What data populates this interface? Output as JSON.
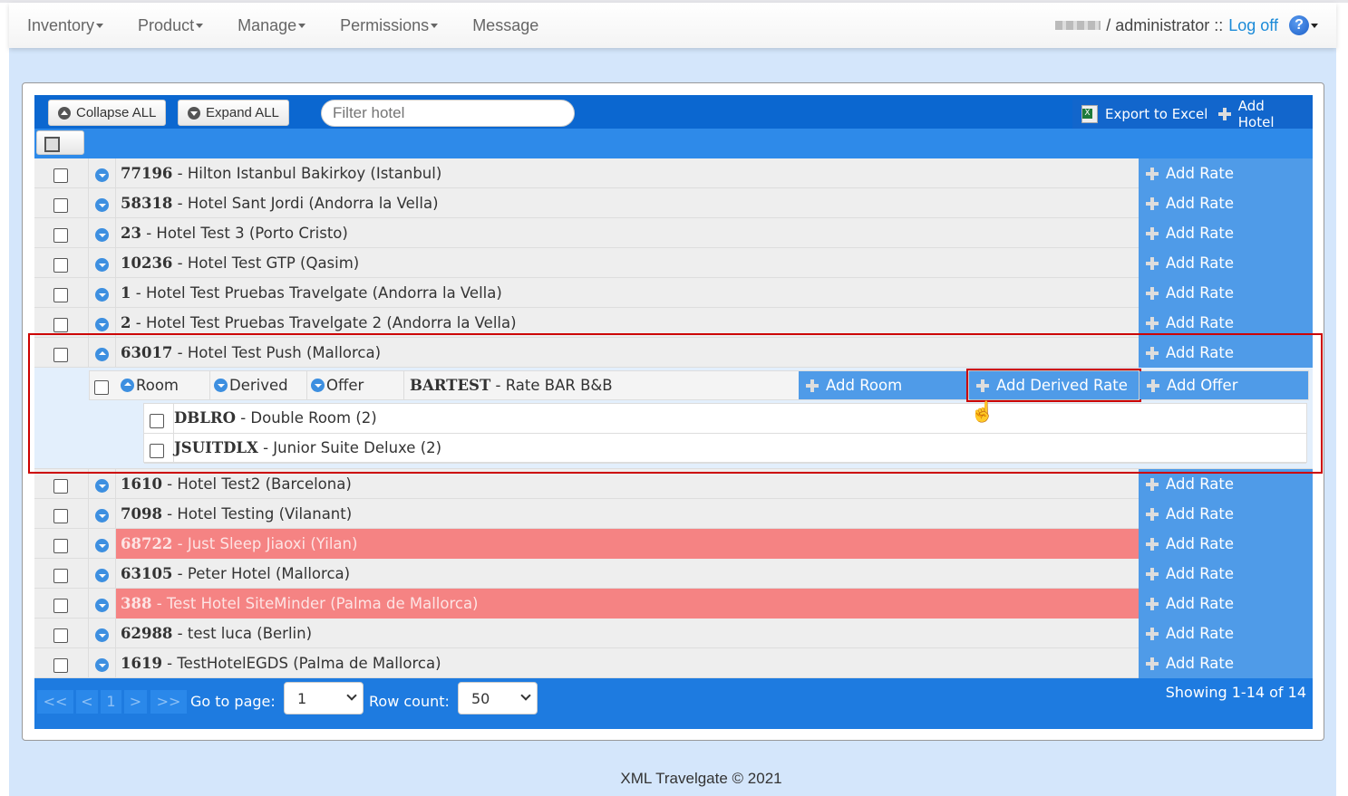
{
  "nav": {
    "items": [
      {
        "label": "Inventory",
        "caret": true
      },
      {
        "label": "Product",
        "caret": true
      },
      {
        "label": "Manage",
        "caret": true
      },
      {
        "label": "Permissions",
        "caret": true
      },
      {
        "label": "Message",
        "caret": false
      }
    ],
    "user_role": "/ administrator ::",
    "logoff": "Log off",
    "help_icon": "question-circle-icon"
  },
  "toolbar": {
    "collapse_all": "Collapse ALL",
    "expand_all": "Expand ALL",
    "filter_placeholder": "Filter hotel",
    "export": "Export to Excel",
    "add_hotel": "Add Hotel"
  },
  "add_rate_label": "Add Rate",
  "hotels_before": [
    {
      "code": "77196",
      "name": "Hilton Istanbul Bakirkoy (Istanbul)",
      "highlight": false
    },
    {
      "code": "58318",
      "name": "Hotel Sant Jordi (Andorra la Vella)",
      "highlight": false
    },
    {
      "code": "23",
      "name": "Hotel Test 3 (Porto Cristo)",
      "highlight": false
    },
    {
      "code": "10236",
      "name": "Hotel Test GTP (Qasim)",
      "highlight": false
    },
    {
      "code": "1",
      "name": "Hotel Test Pruebas Travelgate (Andorra la Vella)",
      "highlight": false
    },
    {
      "code": "2",
      "name": "Hotel Test Pruebas Travelgate 2 (Andorra la Vella)",
      "highlight": false
    },
    {
      "code": "63017",
      "name": "Hotel Test Push (Mallorca)",
      "highlight": false,
      "expanded": true
    }
  ],
  "expanded": {
    "tabs": [
      "Room",
      "Derived",
      "Offer"
    ],
    "rate_code": "BARTEST",
    "rate_name": "Rate BAR B&B",
    "add_room": "Add Room",
    "add_derived": "Add Derived Rate",
    "add_offer": "Add Offer",
    "rooms": [
      {
        "code": "DBLRO",
        "name": "Double Room (2)"
      },
      {
        "code": "JSUITDLX",
        "name": "Junior Suite Deluxe (2)"
      }
    ]
  },
  "hotels_after": [
    {
      "code": "1610",
      "name": "Hotel Test2 (Barcelona)",
      "highlight": false
    },
    {
      "code": "7098",
      "name": "Hotel Testing (Vilanant)",
      "highlight": false
    },
    {
      "code": "68722",
      "name": "Just Sleep Jiaoxi (Yilan)",
      "highlight": true
    },
    {
      "code": "63105",
      "name": "Peter Hotel (Mallorca)",
      "highlight": false
    },
    {
      "code": "388",
      "name": "Test Hotel SiteMinder (Palma de Mallorca)",
      "highlight": true
    },
    {
      "code": "62988",
      "name": "test luca (Berlin)",
      "highlight": false
    },
    {
      "code": "1619",
      "name": "TestHotelEGDS (Palma de Mallorca)",
      "highlight": false
    }
  ],
  "pager": {
    "first": "<<",
    "prev": "<",
    "page": "1",
    "next": ">",
    "last": ">>",
    "goto_label": "Go to page:",
    "goto_value": "1",
    "rowcount_label": "Row count:",
    "rowcount_value": "50",
    "showing": "Showing 1-14 of 14"
  },
  "footer": "XML Travelgate © 2021",
  "colors": {
    "toolbar": "#0b67d0",
    "header": "#2e8ae9",
    "button": "#4f9be8",
    "highlight_row": "#f58383",
    "page_bg": "#d4e6fb",
    "annotation": "#cc0000"
  }
}
